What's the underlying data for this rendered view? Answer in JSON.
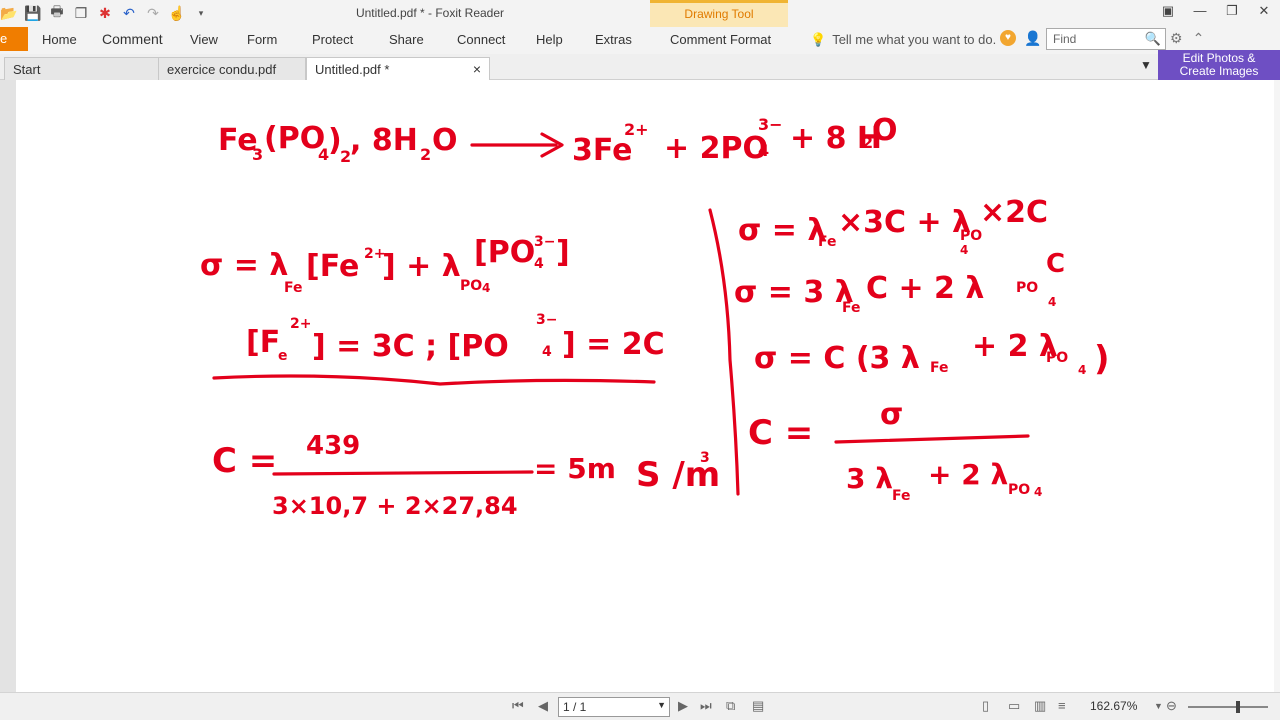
{
  "window": {
    "title": "Untitled.pdf * - Foxit Reader",
    "context_tab": "Drawing Tool",
    "file_tab": "e"
  },
  "ribbon": {
    "menus": [
      "Home",
      "Comment",
      "View",
      "Form",
      "Protect",
      "Share",
      "Connect",
      "Help",
      "Extras",
      "Comment Format"
    ],
    "tell_me": "Tell me what you want to do.",
    "find_placeholder": "Find"
  },
  "tabs": [
    {
      "label": "Start"
    },
    {
      "label": "exercice condu.pdf"
    },
    {
      "label": "Untitled.pdf *"
    }
  ],
  "promo": {
    "line1": "Edit Photos &",
    "line2": "Create Images"
  },
  "status": {
    "page_indicator": "1 / 1",
    "zoom": "162.67%"
  },
  "colors": {
    "ink": "#e3001b",
    "accent_orange": "#f07d00",
    "drawing_tool_bg": "#fbe7b5",
    "promo_bg": "#6e4fc3"
  },
  "ink": {
    "l1": {
      "a": "Fe",
      "b": "3",
      "c": "(PO",
      "d": "4",
      "e": ")",
      "f": "2",
      "g": ", 8H",
      "h": "2",
      "i": "O",
      "j": "3Fe",
      "k": "2+",
      "l": "+ 2PO",
      "m": "3−",
      "n": "4",
      "o": "+ 8 H",
      "p": "2",
      "q": "O"
    },
    "l2": {
      "a": "σ = λ",
      "b": "Fe",
      "c": "[Fe",
      "d": "2+",
      "e": "] + λ",
      "f": "PO",
      "g": "4",
      "h": "[PO",
      "i": "3−",
      "j": "4",
      "k": "]"
    },
    "l3": {
      "a": "[F",
      "b": "e",
      "c": "2+",
      "d": "] = 3C ;  [PO",
      "e": "3−",
      "f": "4",
      "g": "] = 2C"
    },
    "l4": {
      "a": "C =",
      "b": "439",
      "c": "3×10,7 + 2×27,84",
      "d": "= 5m",
      "e": "S /m",
      "f": "3"
    },
    "r1": {
      "a": "σ = λ",
      "b": "Fe",
      "c": "×3C + λ",
      "d": "PO",
      "e": "4",
      "f": "×2C"
    },
    "r2": {
      "a": "σ = 3 λ",
      "b": "Fe",
      "c": "C + 2 λ",
      "d": "PO",
      "e": "4",
      "f": "C"
    },
    "r3": {
      "a": "σ = C (3 λ",
      "b": "Fe",
      "c": "+ 2 λ",
      "d": "PO",
      "e": "4",
      "f": ")"
    },
    "r4": {
      "a": "C =",
      "b": "σ",
      "c": "3 λ",
      "d": "Fe",
      "e": "+ 2 λ",
      "f": "PO",
      "g": "4"
    }
  }
}
